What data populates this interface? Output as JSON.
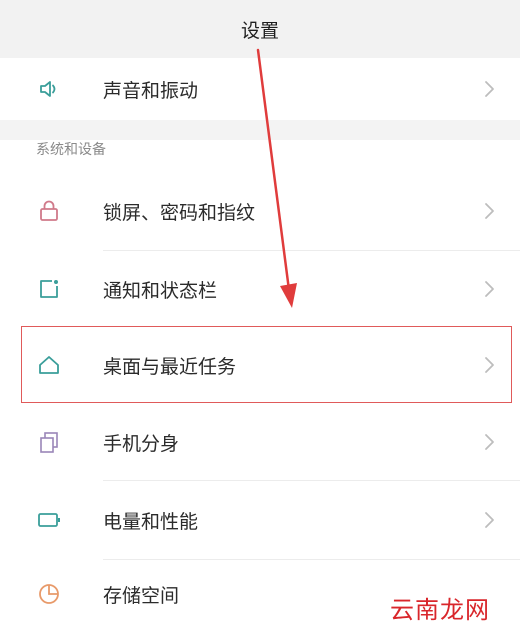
{
  "header": {
    "title": "设置"
  },
  "section": {
    "title": "系统和设备"
  },
  "items": [
    {
      "label": "声音和振动",
      "icon": "speaker-icon"
    },
    {
      "label": "锁屏、密码和指纹",
      "icon": "lock-icon"
    },
    {
      "label": "通知和状态栏",
      "icon": "notification-icon"
    },
    {
      "label": "桌面与最近任务",
      "icon": "home-icon",
      "highlighted": true
    },
    {
      "label": "手机分身",
      "icon": "clone-icon"
    },
    {
      "label": "电量和性能",
      "icon": "battery-icon"
    },
    {
      "label": "存储空间",
      "icon": "storage-icon"
    }
  ],
  "colors": {
    "icon_stroke": "#3a9e9a",
    "lock_icon": "#d07a8a",
    "clone_icon": "#9a86b8",
    "storage_icon": "#e89a6a",
    "annotation": "#e03c3c"
  },
  "watermark": "云南龙网"
}
